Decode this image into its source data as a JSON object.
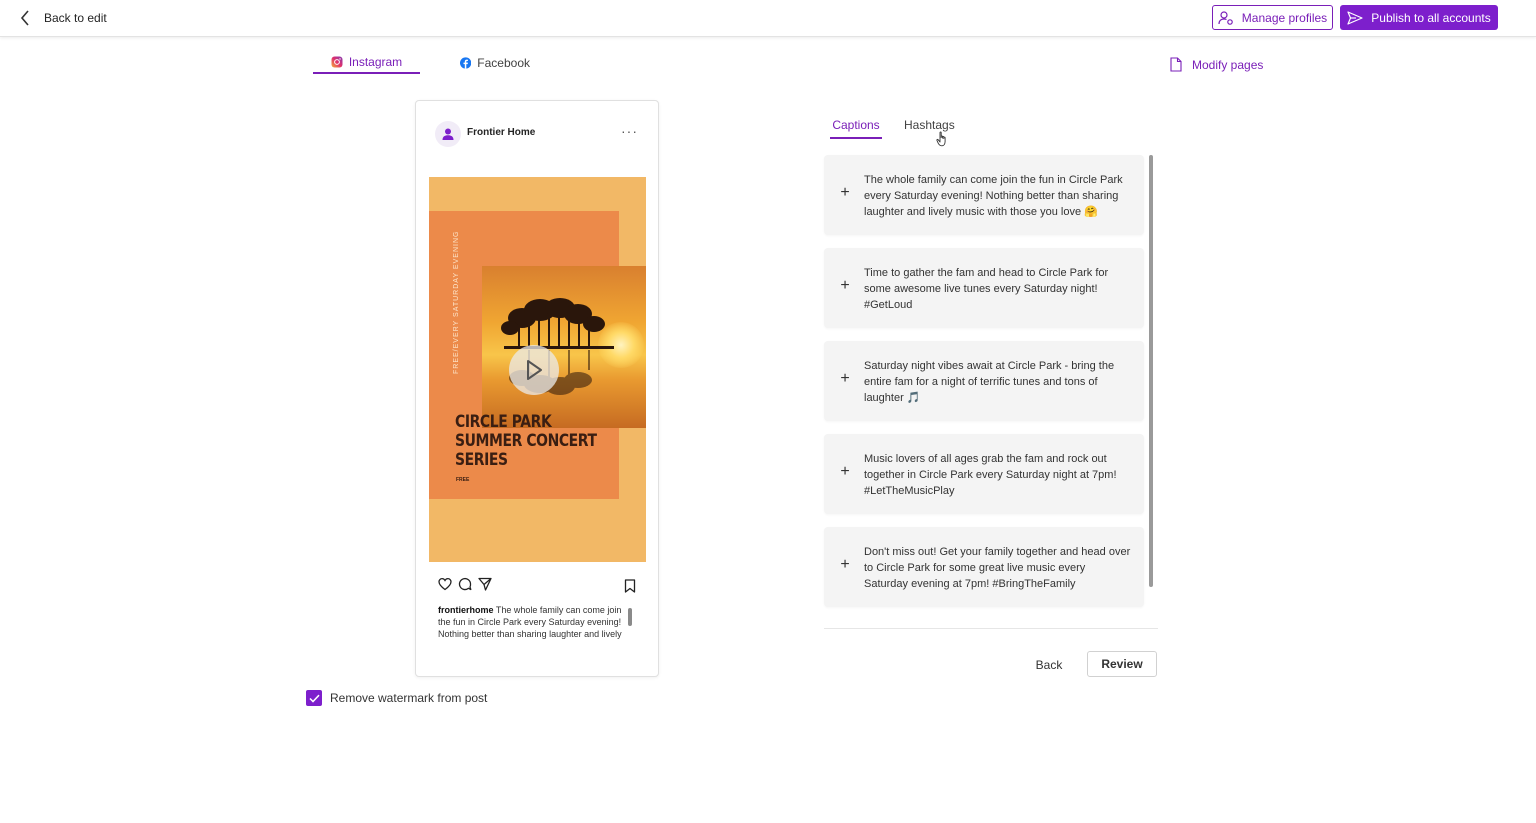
{
  "header": {
    "back_label": "Back to edit",
    "manage_profiles_label": "Manage profiles",
    "publish_label": "Publish to all accounts"
  },
  "platform_tabs": [
    {
      "label": "Instagram",
      "selected": true
    },
    {
      "label": "Facebook",
      "selected": false
    }
  ],
  "modify_pages_label": "Modify pages",
  "preview": {
    "profile_name": "Frontier Home",
    "post": {
      "vertical_text": "FREE/EVERY SATURDAY EVENING",
      "title_lines": [
        "CIRCLE PARK",
        "SUMMER CONCERT",
        "SERIES"
      ],
      "tag": "FREE"
    },
    "caption_user": "frontierhome",
    "caption_text": "The whole family can come join the fun in Circle Park every Saturday evening! Nothing better than sharing laughter and lively music with those you love"
  },
  "watermark": {
    "label": "Remove watermark from post",
    "checked": true
  },
  "caption_tabs": [
    {
      "label": "Captions",
      "selected": true
    },
    {
      "label": "Hashtags",
      "selected": false
    }
  ],
  "captions": [
    {
      "text": "The whole family can come join the fun in Circle Park every Saturday evening! Nothing better than sharing laughter and lively music with those you love 🤗"
    },
    {
      "text": "Time to gather the fam and head to Circle Park for some awesome live tunes every Saturday night! #GetLoud"
    },
    {
      "text": "Saturday night vibes await at Circle Park - bring the entire fam for a night of terrific tunes and tons of laughter 🎵"
    },
    {
      "text": "Music lovers of all ages grab the fam and rock out together in Circle Park every Saturday night at 7pm! #LetTheMusicPlay"
    },
    {
      "text": "Don't miss out! Get your family together and head over to Circle Park for some great live music every Saturday evening at 7pm! #BringTheFamily"
    }
  ],
  "footer": {
    "back_label": "Back",
    "review_label": "Review"
  },
  "colors": {
    "accent": "#7d1fcc",
    "post_background": "#f2b866",
    "post_panel": "#ec8a4a"
  }
}
